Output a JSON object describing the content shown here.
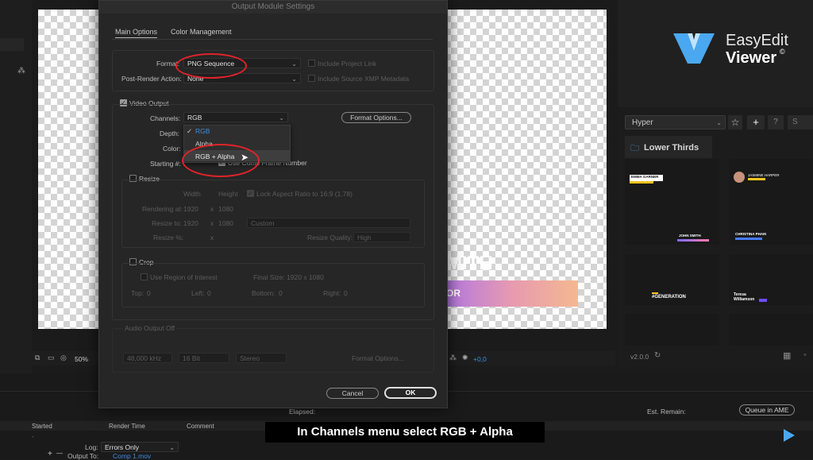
{
  "dialog": {
    "title": "Output Module Settings",
    "tabs": [
      "Main Options",
      "Color Management"
    ],
    "format": {
      "label": "Format:",
      "value": "PNG Sequence"
    },
    "post_render": {
      "label": "Post-Render Action:",
      "value": "None"
    },
    "include_project_link": "Include Project Link",
    "include_xmp": "Include Source XMP Metadata",
    "video_output": {
      "label": "Video Output",
      "channels_label": "Channels:",
      "channels_value": "RGB",
      "depth_label": "Depth:",
      "color_label": "Color:",
      "starting_label": "Starting #:",
      "use_comp_frame": "Use Comp Frame Number",
      "format_options": "Format Options..."
    },
    "dropdown": {
      "items": [
        "RGB",
        "Alpha",
        "RGB + Alpha"
      ],
      "checked": "✓"
    },
    "resize": {
      "label": "Resize",
      "width": "Width",
      "height": "Height",
      "lock_aspect": "Lock Aspect Ratio to 16:9 (1.78)",
      "rendering_at": "Rendering at:",
      "resize_to": "Resize to:",
      "resize_pct": "Resize %:",
      "w": "1920",
      "h": "1080",
      "x": "x",
      "custom": "Custom",
      "quality_label": "Resize Quality:",
      "quality": "High"
    },
    "crop": {
      "label": "Crop",
      "use_roi": "Use Region of Interest",
      "final_size": "Final Size: 1920 x 1080",
      "top": "Top:",
      "left": "Left:",
      "bottom": "Bottom:",
      "right": "Right:",
      "zero": "0"
    },
    "audio": {
      "label": "Audio Output Off",
      "rate": "48,000 kHz",
      "bits": "16 Bit",
      "channels": "Stereo",
      "format_options": "Format Options..."
    },
    "cancel": "Cancel",
    "ok": "OK"
  },
  "viewer": {
    "zoom": "50%",
    "offset": "+0,0",
    "overlay_text_1": "MITH",
    "overlay_text_2": "OR"
  },
  "easyedit": {
    "brand_line1": "EasyEdit",
    "brand_line2": "Viewer",
    "reg": "©",
    "search_select": "Hyper",
    "star": "☆",
    "plus": "+",
    "help": "?",
    "search_short": "S",
    "folder": "Lower Thirds",
    "cards": [
      "EMMA GARNER",
      "JASMINE HARPER",
      "JOHN SMITH",
      "CHRISTINA PHAM",
      "#GENERATION",
      "Teresa Williamson"
    ],
    "version": "v2.0.0"
  },
  "queue": {
    "elapsed": "Elapsed:",
    "est_remain": "Est. Remain:",
    "queue_ame": "Queue in AME",
    "cols": [
      "Started",
      "Render Time",
      "Comment"
    ],
    "dash": "-",
    "log_label": "Log:",
    "log_value": "Errors Only",
    "output_label": "Output To:",
    "output_value": "Comp 1.mov",
    "plus": "+",
    "minus": "—"
  },
  "caption": "In Channels menu select RGB + Alpha",
  "colors": {
    "accent": "#3d8ee0",
    "red_ring": "#e0232a"
  }
}
